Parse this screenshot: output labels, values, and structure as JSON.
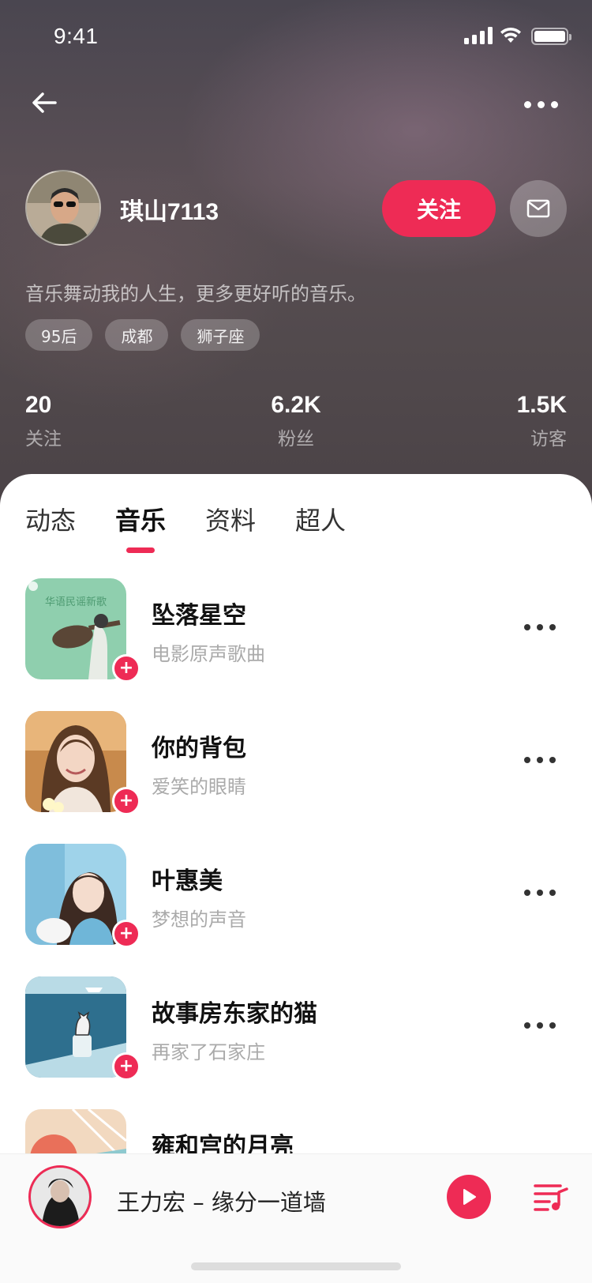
{
  "status": {
    "time": "9:41"
  },
  "profile": {
    "name": "琪山7113",
    "follow_label": "关注",
    "bio": "音乐舞动我的人生，更多更好听的音乐。",
    "tags": [
      "95后",
      "成都",
      "狮子座"
    ],
    "stats": [
      {
        "value": "20",
        "label": "关注"
      },
      {
        "value": "6.2K",
        "label": "粉丝"
      },
      {
        "value": "1.5K",
        "label": "访客"
      }
    ]
  },
  "tabs": [
    {
      "label": "动态",
      "active": false
    },
    {
      "label": "音乐",
      "active": true
    },
    {
      "label": "资料",
      "active": false
    },
    {
      "label": "超人",
      "active": false
    }
  ],
  "songs": [
    {
      "title": "坠落星空",
      "subtitle": "电影原声歌曲",
      "cover_text": "华语民谣新歌"
    },
    {
      "title": "你的背包",
      "subtitle": "爱笑的眼睛"
    },
    {
      "title": "叶惠美",
      "subtitle": "梦想的声音"
    },
    {
      "title": "故事房东家的猫",
      "subtitle": "再家了石家庄"
    },
    {
      "title": "雍和宫的月亮",
      "subtitle": ""
    }
  ],
  "player": {
    "now_playing": "王力宏 – 缘分一道墙"
  },
  "colors": {
    "accent": "#ee2b55"
  },
  "icons": [
    "back-arrow-icon",
    "more-icon",
    "mail-icon",
    "play-icon",
    "playlist-icon",
    "plus-icon"
  ]
}
